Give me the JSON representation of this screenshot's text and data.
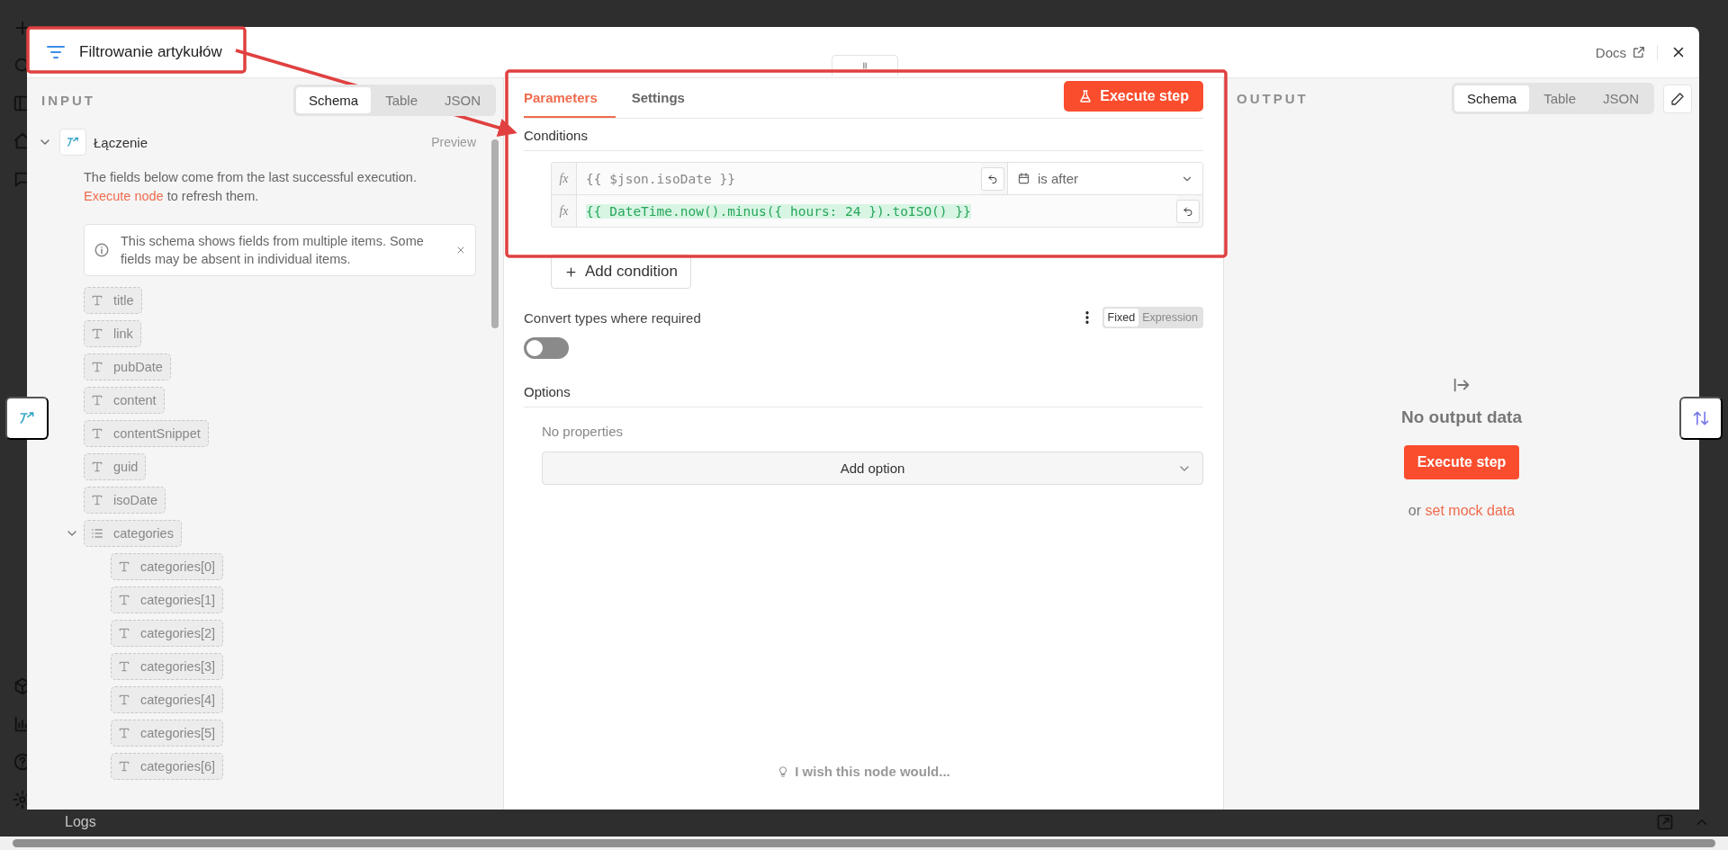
{
  "node": {
    "title": "Filtrowanie artykułów",
    "docs": "Docs"
  },
  "input": {
    "heading": "INPUT",
    "views": [
      {
        "label": "Schema",
        "selected": true
      },
      {
        "label": "Table",
        "selected": false
      },
      {
        "label": "JSON",
        "selected": false
      }
    ],
    "source": {
      "name": "Łączenie",
      "preview": "Preview",
      "expanded": true
    },
    "hint": {
      "before": "The fields below come from the last successful execution.",
      "link": "Execute node",
      "after": "to refresh them."
    },
    "info": "This schema shows fields from multiple items. Some fields may be absent in individual items.",
    "fields": [
      {
        "kind": "string",
        "name": "title"
      },
      {
        "kind": "string",
        "name": "link"
      },
      {
        "kind": "string",
        "name": "pubDate"
      },
      {
        "kind": "string",
        "name": "content"
      },
      {
        "kind": "string",
        "name": "contentSnippet"
      },
      {
        "kind": "string",
        "name": "guid"
      },
      {
        "kind": "string",
        "name": "isoDate"
      },
      {
        "kind": "array",
        "name": "categories",
        "expanded": true,
        "children": [
          {
            "kind": "string",
            "name": "categories[0]"
          },
          {
            "kind": "string",
            "name": "categories[1]"
          },
          {
            "kind": "string",
            "name": "categories[2]"
          },
          {
            "kind": "string",
            "name": "categories[3]"
          },
          {
            "kind": "string",
            "name": "categories[4]"
          },
          {
            "kind": "string",
            "name": "categories[5]"
          },
          {
            "kind": "string",
            "name": "categories[6]"
          }
        ]
      }
    ]
  },
  "parameters": {
    "tabs": [
      {
        "label": "Parameters",
        "selected": true
      },
      {
        "label": "Settings",
        "selected": false
      }
    ],
    "execute": "Execute step",
    "conditions_label": "Conditions",
    "conditions": [
      {
        "left_prefix": "fx",
        "left": "{{ $json.isoDate }}",
        "operator": "is after",
        "right_prefix": "fx",
        "right": "{{ DateTime.now().minus({ hours: 24 }).toISO() }}"
      }
    ],
    "add_condition": "Add condition",
    "convert": {
      "label": "Convert types where required",
      "on": false,
      "modes": [
        {
          "label": "Fixed",
          "selected": true
        },
        {
          "label": "Expression",
          "selected": false
        }
      ]
    },
    "options_label": "Options",
    "no_properties": "No properties",
    "add_option": "Add option",
    "feedback": "I wish this node would..."
  },
  "output": {
    "heading": "OUTPUT",
    "views": [
      {
        "label": "Schema",
        "selected": true
      },
      {
        "label": "Table",
        "selected": false
      },
      {
        "label": "JSON",
        "selected": false
      }
    ],
    "empty_title": "No output data",
    "execute": "Execute step",
    "mock_prefix": "or",
    "mock_link": "set mock data"
  },
  "logs": "Logs"
}
